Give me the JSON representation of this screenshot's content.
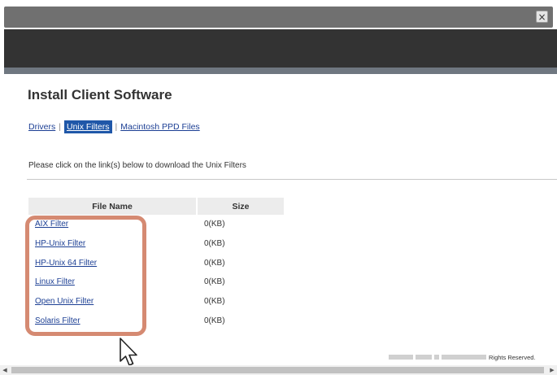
{
  "window": {
    "close_symbol": "×"
  },
  "page": {
    "title": "Install Client Software",
    "tabs": [
      {
        "label": "Drivers",
        "active": false
      },
      {
        "label": "Unix Filters",
        "active": true
      },
      {
        "label": "Macintosh PPD Files",
        "active": false
      }
    ],
    "tab_separator": "|",
    "instructions": "Please click on the link(s) below to download the Unix Filters"
  },
  "table": {
    "headers": {
      "name": "File Name",
      "size": "Size"
    },
    "rows": [
      {
        "name": "AIX Filter",
        "size": "0(KB)"
      },
      {
        "name": "HP-Unix Filter",
        "size": "0(KB)"
      },
      {
        "name": "HP-Unix 64 Filter",
        "size": "0(KB)"
      },
      {
        "name": "Linux Filter",
        "size": "0(KB)"
      },
      {
        "name": "Open Unix Filter",
        "size": "0(KB)"
      },
      {
        "name": "Solaris Filter",
        "size": "0(KB)"
      }
    ]
  },
  "footer": {
    "text": "Rights Reserved."
  },
  "scrollbar": {
    "left_arrow": "◀",
    "right_arrow": "▶"
  },
  "colors": {
    "header": "#333333",
    "link": "#1c3f94",
    "active_tab": "#1f57a8",
    "highlight": "#d58a72"
  }
}
